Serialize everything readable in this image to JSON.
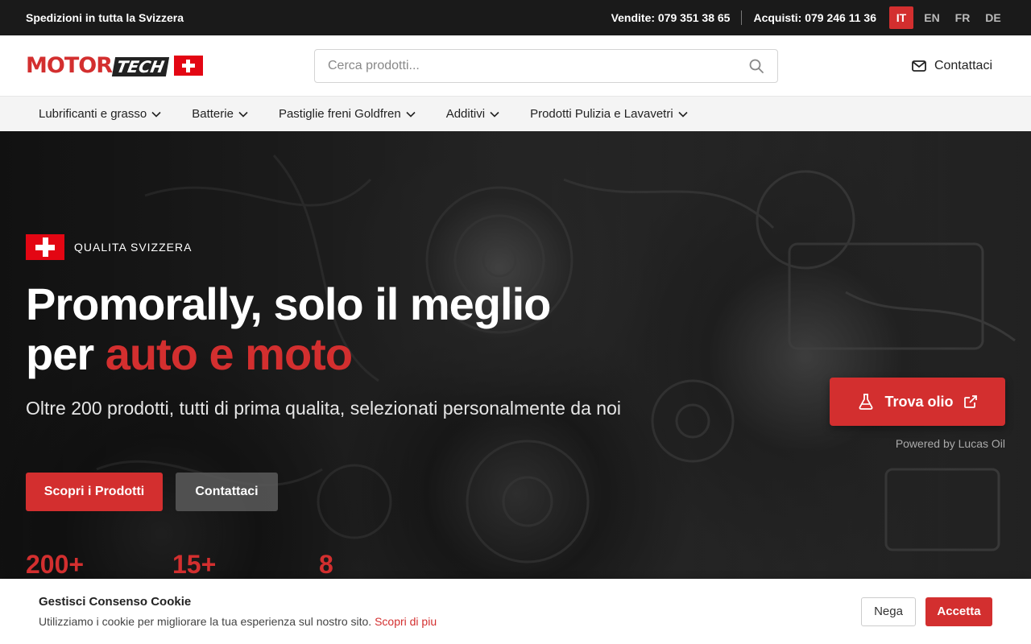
{
  "topbar": {
    "shipping": "Spedizioni in tutta la Svizzera",
    "sales": "Vendite: 079 351 38 65",
    "purchases": "Acquisti: 079 246 11 36",
    "languages": [
      "IT",
      "EN",
      "FR",
      "DE"
    ],
    "active_language": "IT"
  },
  "header": {
    "logo_motor": "MOTOR",
    "logo_tech": "TECH",
    "search_placeholder": "Cerca prodotti...",
    "contact_label": "Contattaci"
  },
  "nav": {
    "items": [
      {
        "label": "Lubrificanti e grasso"
      },
      {
        "label": "Batterie"
      },
      {
        "label": "Pastiglie freni Goldfren"
      },
      {
        "label": "Additivi"
      },
      {
        "label": "Prodotti Pulizia e Lavavetri"
      }
    ]
  },
  "hero": {
    "badge": "QUALITA SVIZZERA",
    "title_line1": "Promorally, solo il meglio",
    "title_line2_prefix": "per ",
    "title_accent": "auto e moto",
    "subtitle": "Oltre 200 prodotti, tutti di prima qualita, selezionati personalmente da noi",
    "primary_button": "Scopri i Prodotti",
    "secondary_button": "Contattaci",
    "stats": [
      "200+",
      "15+",
      "8"
    ],
    "oil_button": "Trova olio",
    "powered_by": "Powered by Lucas Oil"
  },
  "cookie": {
    "title": "Gestisci Consenso Cookie",
    "description": "Utilizziamo i cookie per migliorare la tua esperienza sul nostro sito.",
    "link": "Scopri di piu",
    "deny": "Nega",
    "accept": "Accetta"
  },
  "colors": {
    "accent": "#d32f2f",
    "topbar": "#1a1a1a",
    "nav_bg": "#f4f4f4"
  }
}
